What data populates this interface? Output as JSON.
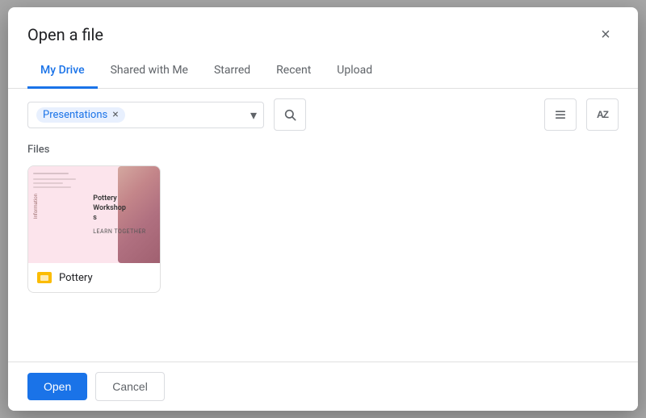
{
  "dialog": {
    "title": "Open a file",
    "close_label": "×"
  },
  "tabs": [
    {
      "id": "my-drive",
      "label": "My Drive",
      "active": true
    },
    {
      "id": "shared-with-me",
      "label": "Shared with Me",
      "active": false
    },
    {
      "id": "starred",
      "label": "Starred",
      "active": false
    },
    {
      "id": "recent",
      "label": "Recent",
      "active": false
    },
    {
      "id": "upload",
      "label": "Upload",
      "active": false
    }
  ],
  "toolbar": {
    "filter_chip_label": "Presentations",
    "filter_chip_close": "×",
    "dropdown_icon": "▾",
    "search_icon": "🔍",
    "list_view_icon": "≡",
    "sort_icon": "AZ"
  },
  "content": {
    "section_label": "Files",
    "files": [
      {
        "id": "pottery",
        "name": "Pottery",
        "type": "slides",
        "heading": "Pottery Workshops",
        "subtext": "Learn together"
      }
    ]
  },
  "footer": {
    "open_label": "Open",
    "cancel_label": "Cancel"
  }
}
